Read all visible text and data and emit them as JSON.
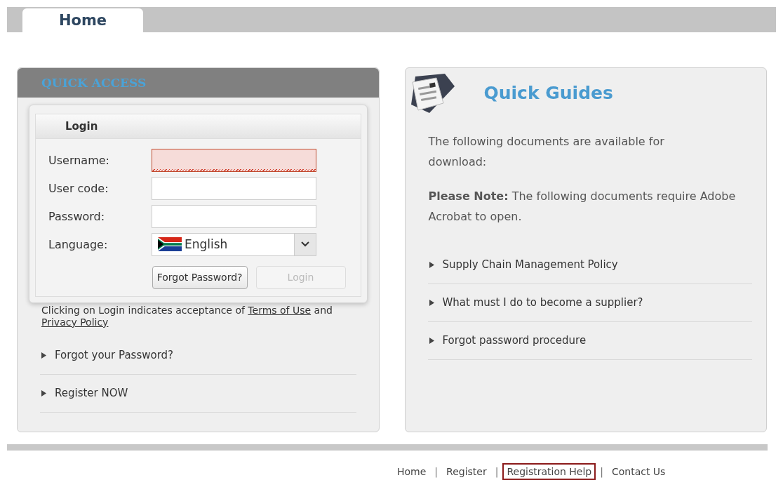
{
  "tabs": [
    {
      "label": "Home",
      "selected": true
    }
  ],
  "quick_access": {
    "title": "QUICK ACCESS",
    "login": {
      "title": "Login",
      "fields": [
        {
          "kind": "text",
          "label": "Username:",
          "error": true
        },
        {
          "kind": "text",
          "label": "User code:",
          "error": false
        },
        {
          "kind": "password",
          "label": "Password:",
          "error": false
        },
        {
          "kind": "select",
          "label": "Language:",
          "value": "English"
        }
      ],
      "buttons": [
        {
          "label": "Forgot Password?",
          "disabled": false
        },
        {
          "label": "Login",
          "disabled": true
        }
      ]
    },
    "notice": {
      "before": "Clicking on Login indicates acceptance of ",
      "terms": "Terms of Use",
      "middle": " and ",
      "privacy": "Privacy Policy"
    },
    "links": [
      "Forgot your Password?",
      "Register NOW"
    ]
  },
  "quick_guides": {
    "title": "Quick Guides",
    "intro": "The following documents are available for download:",
    "note": "**Please Note:** The following documents require Adobe Acrobat to open.",
    "links": [
      "Supply Chain Management Policy",
      "What must I do to become a supplier?",
      "Forgot password procedure"
    ]
  },
  "footer": [
    {
      "label": "Home",
      "highlighted": false
    },
    {
      "separator": "|",
      "label": "Register",
      "highlighted": false
    },
    {
      "separator": "|",
      "label": "Registration Help",
      "highlighted": true
    },
    {
      "separator": "|",
      "label": "Contact Us",
      "highlighted": false
    }
  ]
}
